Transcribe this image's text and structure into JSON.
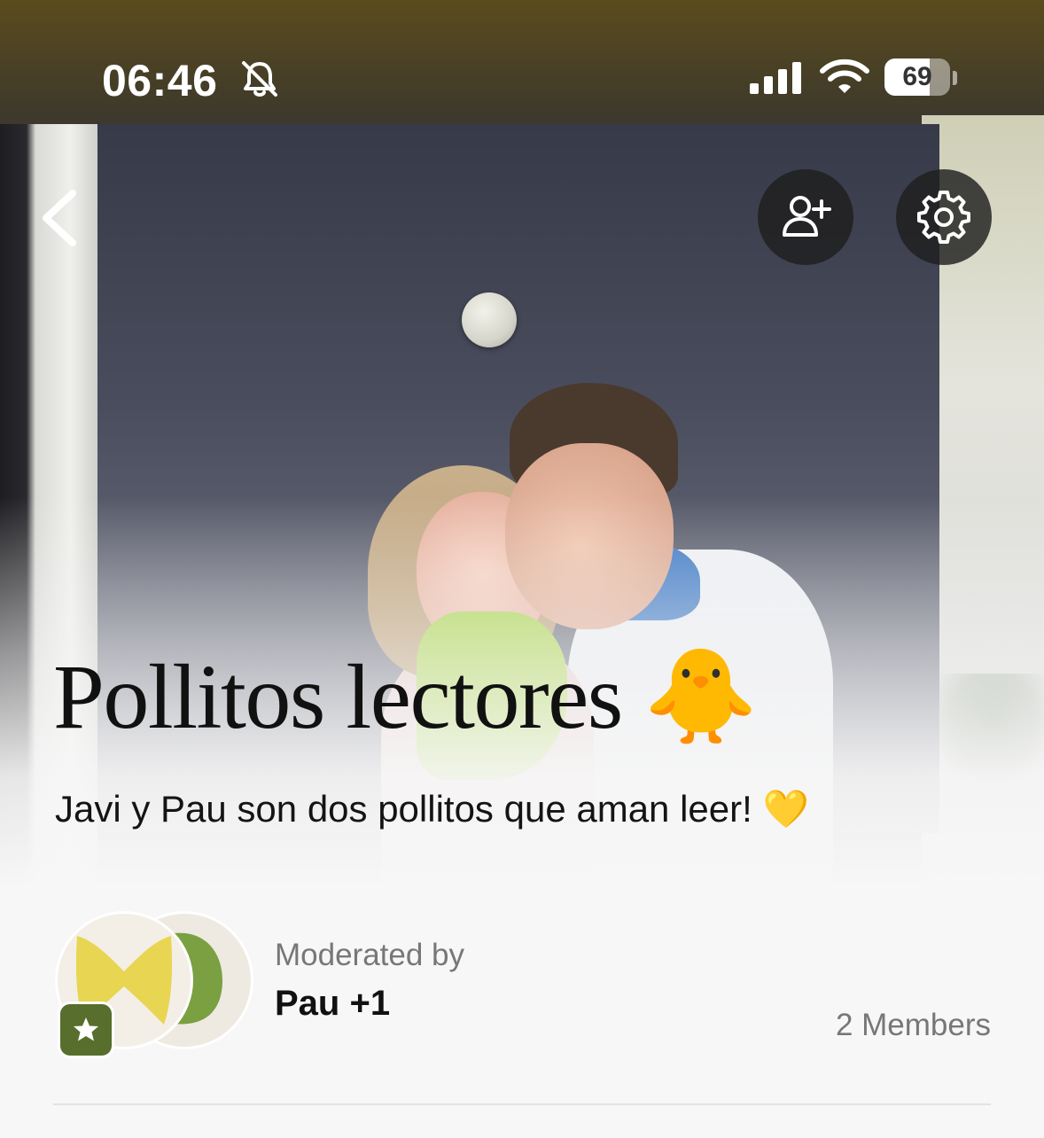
{
  "status_bar": {
    "time": "06:46",
    "battery_percent": 69,
    "battery_label": "69",
    "icons": [
      "bell-slash-icon",
      "cellular-signal-icon",
      "wifi-icon",
      "battery-icon"
    ]
  },
  "nav": {
    "back_icon": "chevron-left-icon",
    "add_member_icon": "person-plus-icon",
    "settings_icon": "gear-icon"
  },
  "club": {
    "title": "Pollitos lectores 🐥",
    "description": "Javi y Pau son dos pollitos que aman leer! 💛"
  },
  "moderators": {
    "label": "Moderated by",
    "names": "Pau +1",
    "members_count": "2 Members",
    "badge_icon": "star-icon"
  },
  "colors": {
    "badge_green": "#586e2c",
    "avatar_yellow": "#e8d552",
    "avatar_green": "#7aa041",
    "button_dark": "#1e1e1e"
  }
}
